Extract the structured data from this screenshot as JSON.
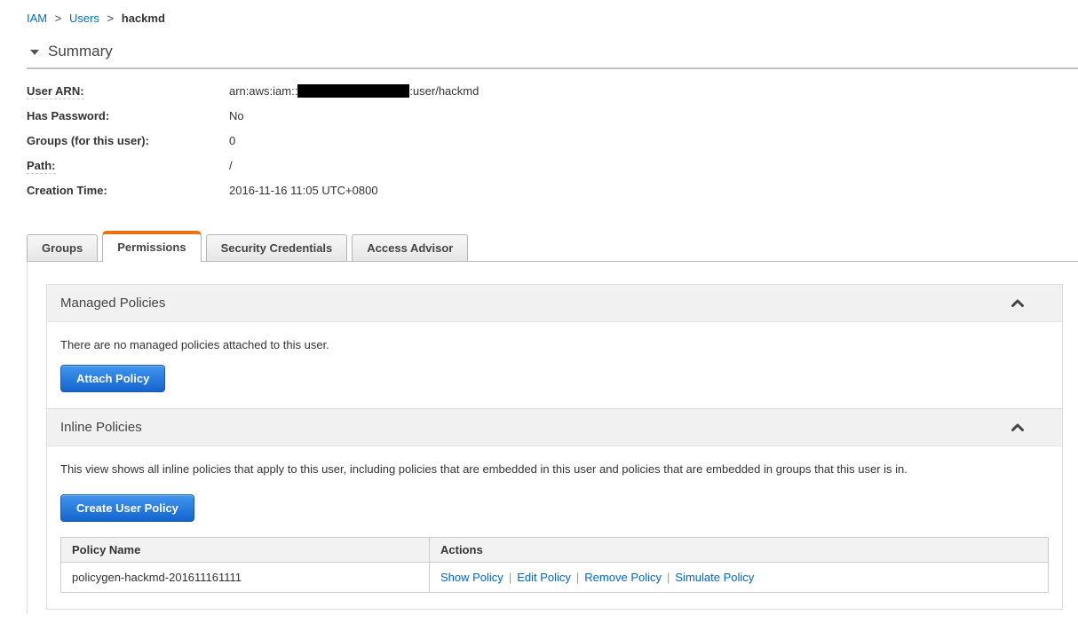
{
  "breadcrumb": {
    "separator": ">",
    "items": [
      {
        "label": "IAM"
      },
      {
        "label": "Users"
      },
      {
        "label": "hackmd"
      }
    ]
  },
  "summary": {
    "collapse_icon": "triangle-down",
    "title": "Summary",
    "fields": [
      {
        "label": "User ARN:",
        "value_prefix": "arn:aws:iam::",
        "redaction": "account-id-hidden",
        "value_suffix": ":user/hackmd"
      },
      {
        "label": "Has Password:",
        "value": "No"
      },
      {
        "label": "Groups (for this user):",
        "value": "0"
      },
      {
        "label": "Path:",
        "value": "/"
      },
      {
        "label": "Creation Time:",
        "value": "2016-11-16 11:05 UTC+0800"
      }
    ]
  },
  "tabs": {
    "items": [
      {
        "label": "Groups",
        "active": false
      },
      {
        "label": "Permissions",
        "active": true
      },
      {
        "label": "Security Credentials",
        "active": false
      },
      {
        "label": "Access Advisor",
        "active": false
      }
    ]
  },
  "panels": {
    "managed": {
      "title": "Managed Policies",
      "collapse_icon": "chevron-up",
      "empty_text": "There are no managed policies attached to this user.",
      "attach_button": "Attach Policy"
    },
    "inline": {
      "title": "Inline Policies",
      "collapse_icon": "chevron-up",
      "description": "This view shows all inline policies that apply to this user, including policies that are embedded in this user and policies that are embedded in groups that this user is in.",
      "create_button": "Create User Policy",
      "table": {
        "headers": [
          "Policy Name",
          "Actions"
        ],
        "action_separator": "|",
        "rows": [
          {
            "policy_name": "policygen-hackmd-201611161111",
            "actions": [
              "Show Policy",
              "Edit Policy",
              "Remove Policy",
              "Simulate Policy"
            ]
          }
        ]
      }
    }
  },
  "colors": {
    "breadcrumb_link": "#0073bb",
    "content_link": "#0066cc",
    "active_tab_accent": "#ec7211",
    "button_gradient_top": "#4196ee",
    "button_gradient_bottom": "#1465cf",
    "redaction": "#000000"
  }
}
